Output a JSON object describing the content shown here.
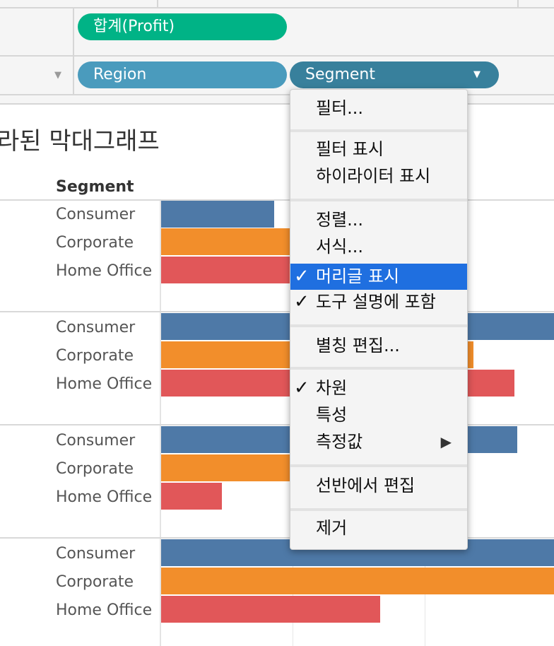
{
  "shelves": {
    "columns_pill": "합계(Profit)",
    "rows_pill_1": "Region",
    "rows_pill_2": "Segment",
    "dropdown_glyph": "▼"
  },
  "chart": {
    "title": "라된 막대그래프",
    "header": "Segment",
    "segments": [
      "Consumer",
      "Corporate",
      "Home Office"
    ],
    "colors": {
      "Consumer": "#4e79a7",
      "Corporate": "#f28e2b",
      "Home Office": "#e15759"
    }
  },
  "menu": {
    "items": [
      {
        "label": "필터...",
        "checked": false
      },
      {
        "label": "필터 표시",
        "checked": false
      },
      {
        "label": "하이라이터 표시",
        "checked": false
      },
      {
        "label": "정렬...",
        "checked": false
      },
      {
        "label": "서식...",
        "checked": false
      },
      {
        "label": "머리글 표시",
        "checked": true,
        "selected": true
      },
      {
        "label": "도구 설명에 포함",
        "checked": true
      },
      {
        "label": "별칭 편집...",
        "checked": false
      },
      {
        "label": "차원",
        "checked": true
      },
      {
        "label": "특성",
        "checked": false
      },
      {
        "label": "측정값",
        "checked": false,
        "submenu": true
      },
      {
        "label": "선반에서 편집",
        "checked": false
      },
      {
        "label": "제거",
        "checked": false
      }
    ],
    "check_glyph": "✓",
    "submenu_glyph": "▶"
  }
}
